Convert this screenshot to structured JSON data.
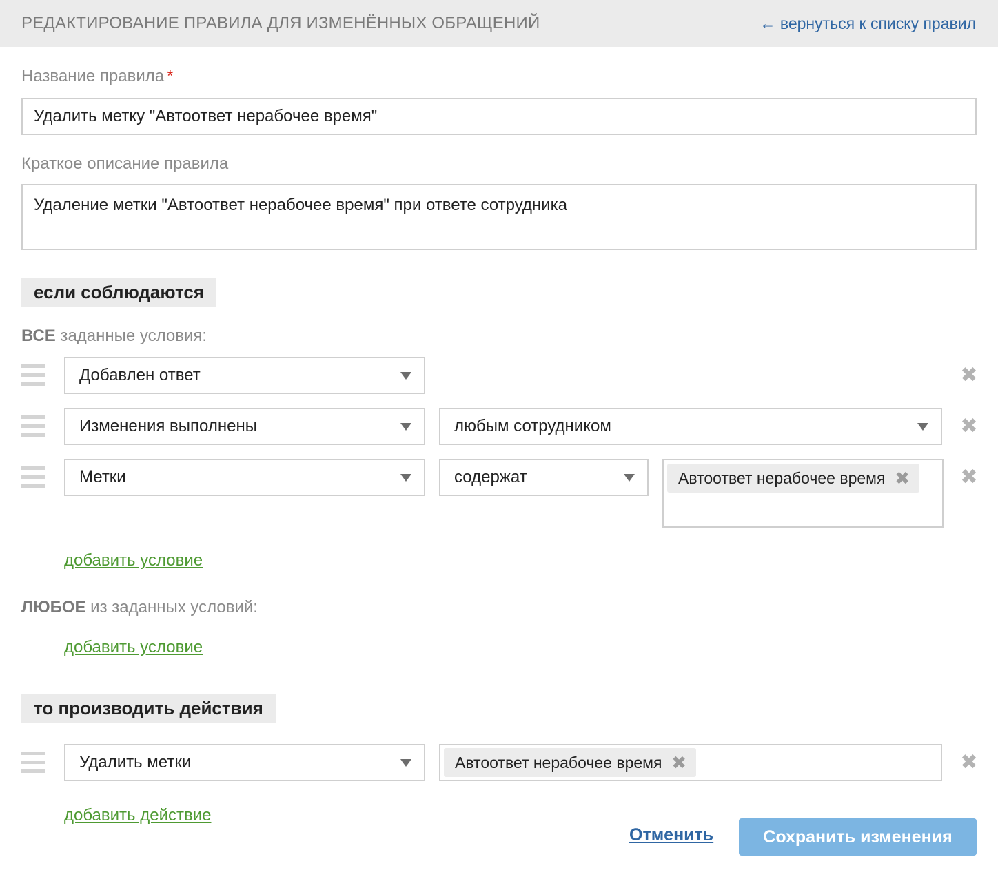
{
  "header": {
    "title": "РЕДАКТИРОВАНИЕ ПРАВИЛА ДЛЯ ИЗМЕНЁННЫХ ОБРАЩЕНИЙ",
    "back_link": "← вернуться к списку правил"
  },
  "form": {
    "name_label": "Название правила",
    "required_mark": "*",
    "name_value": "Удалить метку \"Автоответ нерабочее время\"",
    "desc_label": "Краткое описание правила",
    "desc_value": "Удаление метки \"Автоответ нерабочее время\" при ответе сотрудника"
  },
  "conditions": {
    "section_title": "если соблюдаются",
    "all_group": {
      "keyword": "ВСЕ",
      "suffix": " заданные условия:",
      "rows": [
        {
          "field": "Добавлен ответ"
        },
        {
          "field": "Изменения выполнены",
          "value": "любым сотрудником"
        },
        {
          "field": "Метки",
          "operator": "содержат",
          "tags": [
            "Автоответ нерабочее время"
          ]
        }
      ],
      "add_label": "добавить условие"
    },
    "any_group": {
      "keyword": "ЛЮБОЕ",
      "suffix": " из заданных условий:",
      "add_label": "добавить условие"
    }
  },
  "actions": {
    "section_title": "то производить действия",
    "rows": [
      {
        "action": "Удалить метки",
        "tags": [
          "Автоответ нерабочее время"
        ]
      }
    ],
    "add_label": "добавить действие"
  },
  "buttons": {
    "cancel": "Отменить",
    "save": "Сохранить изменения"
  },
  "icons": {
    "remove": "✖",
    "caret": "caret-down-icon",
    "handle": "drag-handle-icon"
  },
  "colors": {
    "link_blue": "#2f66a3",
    "link_green": "#4e9a32",
    "save_button": "#7cb5e2",
    "required": "#d9281d"
  }
}
